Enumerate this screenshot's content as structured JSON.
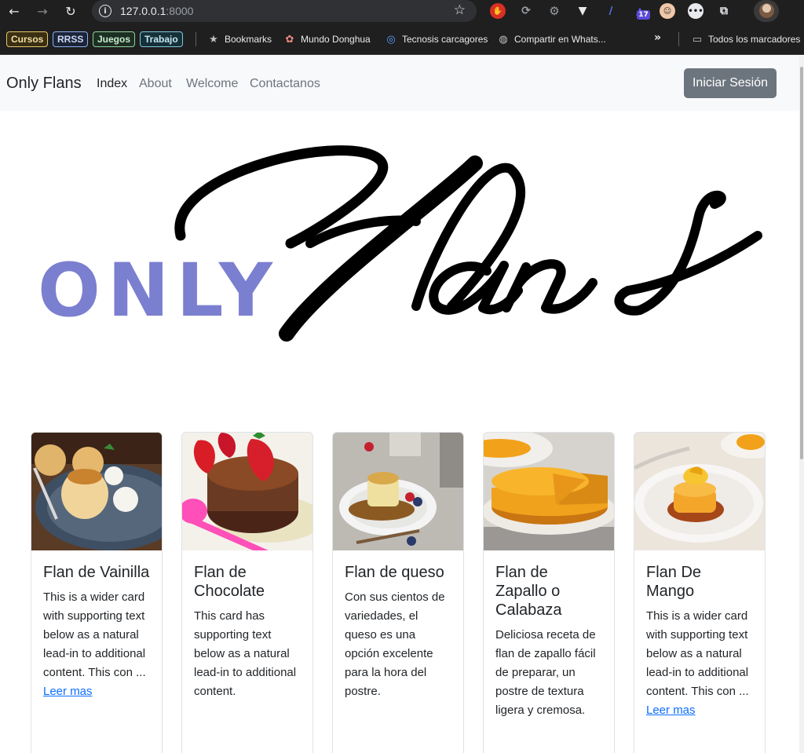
{
  "browser": {
    "url_host": "127.0.0.1",
    "url_port": ":8000",
    "extension_badge": "17",
    "bookmark_tags": [
      "Cursos",
      "RRSS",
      "Juegos",
      "Trabajo"
    ],
    "bookmarks": [
      "Bookmarks",
      "Mundo Donghua",
      "Tecnosis carcagores",
      "Compartir en Whats..."
    ],
    "all_bookmarks": "Todos los marcadores"
  },
  "navbar": {
    "brand": "Only Flans",
    "links": [
      "Index",
      "About",
      "Welcome",
      "Contactanos"
    ],
    "login": "Iniciar Sesión"
  },
  "hero": {
    "small_word": "ONLY",
    "script_word": "Flans",
    "colors": {
      "small_word": "#7b7fd0",
      "script_word": "#000000"
    }
  },
  "cards": [
    {
      "title": "Flan de Vainilla",
      "text": "This is a wider card with supporting text below as a natural lead-in to additional content. This con ...",
      "link": "Leer mas"
    },
    {
      "title": "Flan de Chocolate",
      "text": "This card has supporting text below as a natural lead-in to additional content.",
      "link": ""
    },
    {
      "title": "Flan de queso",
      "text": "Con sus cientos de variedades, el queso es una opción excelente para la hora del postre.",
      "link": ""
    },
    {
      "title": "Flan de Zapallo o Calabaza",
      "text": "Deliciosa receta de flan de zapallo fácil de preparar, un postre de textura ligera y cremosa.",
      "link": ""
    },
    {
      "title": "Flan De Mango",
      "text": "This is a wider card with supporting text below as a natural lead-in to additional content. This con ...",
      "link": "Leer mas"
    }
  ]
}
